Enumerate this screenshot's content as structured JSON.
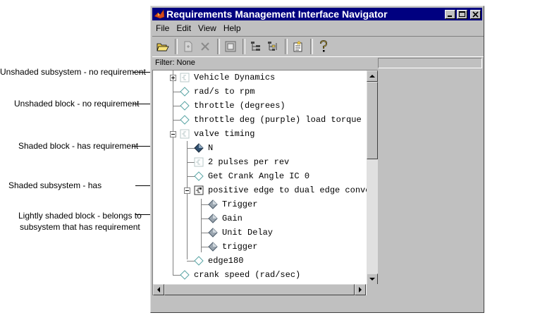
{
  "window": {
    "title": "Requirements Management Interface Navigator",
    "minimize_icon": "minimize-icon",
    "maximize_icon": "maximize-icon",
    "close_icon": "close-icon"
  },
  "menu": {
    "file": "File",
    "edit": "Edit",
    "view": "View",
    "help": "Help"
  },
  "toolbar": {
    "icons": [
      "open-folder-icon",
      "new-document-icon",
      "delete-icon",
      "view-icon",
      "tree-icon",
      "tree-level-icon",
      "report-icon",
      "help-icon"
    ]
  },
  "filter": {
    "label": "Filter: None"
  },
  "tree": {
    "items": [
      {
        "label": "Vehicle Dynamics",
        "icon": "unshaded-subsystem-icon"
      },
      {
        "label": "rad/s to rpm",
        "icon": "unshaded-block-icon"
      },
      {
        "label": "throttle (degrees)",
        "icon": "unshaded-block-icon"
      },
      {
        "label": "throttle deg (purple) load torque l",
        "icon": "unshaded-block-icon"
      },
      {
        "label": "valve timing",
        "icon": "unshaded-subsystem-icon"
      },
      {
        "label": "N",
        "icon": "shaded-block-icon"
      },
      {
        "label": "2 pulses per rev",
        "icon": "unshaded-subsystem-icon"
      },
      {
        "label": "Get Crank Angle IC 0",
        "icon": "unshaded-block-icon"
      },
      {
        "label": "positive edge to dual edge conve",
        "icon": "shaded-subsystem-icon"
      },
      {
        "label": "Trigger",
        "icon": "lightly-shaded-block-icon"
      },
      {
        "label": "Gain",
        "icon": "lightly-shaded-block-icon"
      },
      {
        "label": "Unit Delay",
        "icon": "lightly-shaded-block-icon"
      },
      {
        "label": "trigger",
        "icon": "lightly-shaded-block-icon"
      },
      {
        "label": "edge180",
        "icon": "unshaded-block-icon"
      },
      {
        "label": "crank speed (rad/sec)",
        "icon": "unshaded-block-icon"
      }
    ]
  },
  "callouts": {
    "unshaded_subsystem": "Unshaded subsystem - no requirement",
    "unshaded_block": "Unshaded block - no requirement",
    "shaded_block": "Shaded block - has requirement",
    "shaded_subsystem": "Shaded subsystem - has",
    "lightly_shaded_line1": "Lightly shaded block - belongs to",
    "lightly_shaded_line2": "subsystem that has requirement"
  },
  "colors": {
    "titlebar": "#000080",
    "window_face": "#c0c0c0",
    "icon_outline": "#5aa5a5",
    "icon_shaded": "#2f4f6f",
    "icon_light": "#9aa5af"
  }
}
